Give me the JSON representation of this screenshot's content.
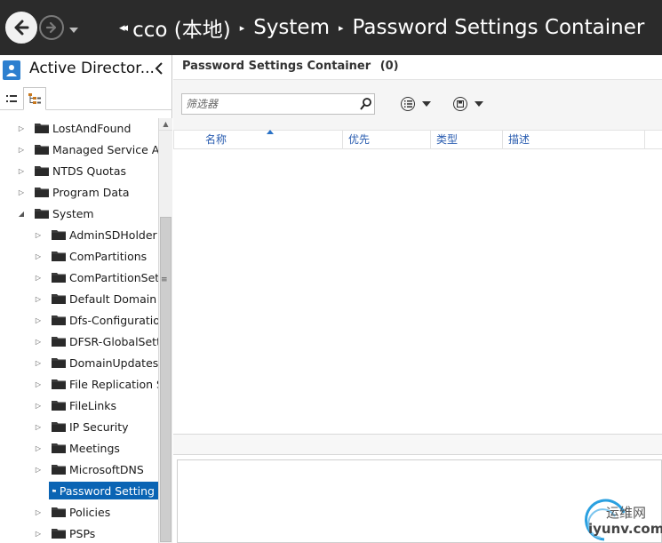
{
  "header": {
    "breadcrumb": [
      {
        "label": "cco (本地)"
      },
      {
        "label": "System"
      },
      {
        "label": "Password Settings Container"
      }
    ]
  },
  "left_panel": {
    "title": "Active Director...",
    "tree": [
      {
        "label": "LostAndFound",
        "level": 1,
        "expanded": false,
        "selected": false
      },
      {
        "label": "Managed Service Ac",
        "level": 1,
        "expanded": false,
        "selected": false
      },
      {
        "label": "NTDS Quotas",
        "level": 1,
        "expanded": false,
        "selected": false
      },
      {
        "label": "Program Data",
        "level": 1,
        "expanded": false,
        "selected": false
      },
      {
        "label": "System",
        "level": 1,
        "expanded": true,
        "selected": false
      },
      {
        "label": "AdminSDHolder",
        "level": 2,
        "expanded": false,
        "selected": false
      },
      {
        "label": "ComPartitions",
        "level": 2,
        "expanded": false,
        "selected": false
      },
      {
        "label": "ComPartitionSets",
        "level": 2,
        "expanded": false,
        "selected": false
      },
      {
        "label": "Default Domain I",
        "level": 2,
        "expanded": false,
        "selected": false
      },
      {
        "label": "Dfs-Configuratio",
        "level": 2,
        "expanded": false,
        "selected": false
      },
      {
        "label": "DFSR-GlobalSett",
        "level": 2,
        "expanded": false,
        "selected": false
      },
      {
        "label": "DomainUpdates",
        "level": 2,
        "expanded": false,
        "selected": false
      },
      {
        "label": "File Replication S",
        "level": 2,
        "expanded": false,
        "selected": false
      },
      {
        "label": "FileLinks",
        "level": 2,
        "expanded": false,
        "selected": false
      },
      {
        "label": "IP Security",
        "level": 2,
        "expanded": false,
        "selected": false
      },
      {
        "label": "Meetings",
        "level": 2,
        "expanded": false,
        "selected": false
      },
      {
        "label": "MicrosoftDNS",
        "level": 2,
        "expanded": false,
        "selected": false
      },
      {
        "label": "Password Setting",
        "level": 2,
        "expanded": null,
        "selected": true
      },
      {
        "label": "Policies",
        "level": 2,
        "expanded": false,
        "selected": false
      },
      {
        "label": "PSPs",
        "level": 2,
        "expanded": false,
        "selected": false
      }
    ]
  },
  "main": {
    "title": "Password Settings Container",
    "count": "(0)",
    "filter_placeholder": "筛选器",
    "columns": [
      {
        "label": "名称"
      },
      {
        "label": "优先"
      },
      {
        "label": "类型"
      },
      {
        "label": "描述"
      }
    ]
  },
  "watermark": {
    "cn": "运维网",
    "en": "iyunv.com"
  },
  "colors": {
    "header_bg": "#2b2b2b",
    "selection": "#0a64b4",
    "column_text": "#2a5db0",
    "accent_blue": "#2c7fcf"
  }
}
